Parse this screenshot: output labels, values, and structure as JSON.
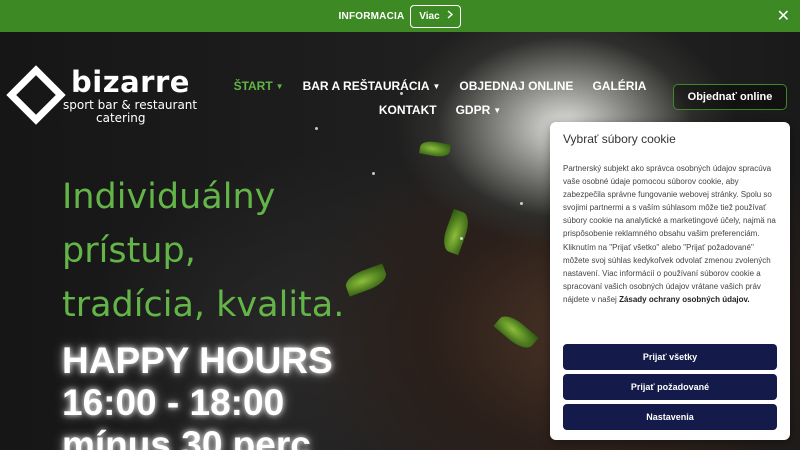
{
  "topbar": {
    "label": "INFORMACIA",
    "more_label": "Viac",
    "more_icon": "chevron-right-icon",
    "close_icon": "close-icon",
    "close_glyph": "✕",
    "background": "#3d8a25"
  },
  "logo": {
    "brand": "bizarre",
    "subtitle_1": "sport bar & restaurant",
    "subtitle_2": "catering"
  },
  "nav": {
    "items": [
      {
        "label": "ŠTART",
        "active": true,
        "has_dropdown": true
      },
      {
        "label": "BAR A REŠTAURÁCIA",
        "active": false,
        "has_dropdown": true
      },
      {
        "label": "OBJEDNAJ ONLINE",
        "active": false,
        "has_dropdown": false
      },
      {
        "label": "GALÉRIA",
        "active": false,
        "has_dropdown": false
      },
      {
        "label": "KONTAKT",
        "active": false,
        "has_dropdown": false
      },
      {
        "label": "GDPR",
        "active": false,
        "has_dropdown": true
      }
    ],
    "accent": "#62b545"
  },
  "order_button": {
    "label": "Objednať online"
  },
  "hero": {
    "lines": [
      "Individuálny",
      "prístup,",
      "tradícia, kvalita."
    ],
    "happy_lines": [
      "HAPPY HOURS",
      "16:00 - 18:00",
      "mínus 30 perc"
    ]
  },
  "cookie": {
    "title": "Vybrať súbory cookie",
    "text": "Partnerský subjekt ako správca osobných údajov spracúva vaše osobné údaje pomocou súborov cookie, aby zabezpečila správne fungovanie webovej stránky. Spolu so svojimi partnermi a s vaším súhlasom môže tiež používať súbory cookie na analytické a marketingové účely, najmä na prispôsobenie reklamného obsahu vašim preferenciám. Kliknutím na \"Prijať všetko\" alebo \"Prijať požadované\" môžete svoj súhlas kedykoľvek odvolať zmenou zvolených nastavení. Viac informácií o používaní súborov cookie a spracovaní vašich osobných údajov vrátane vašich práv nájdete v našej",
    "link": "Zásady ochrany osobných údajov.",
    "buttons": {
      "accept_all": "Prijať všetky",
      "accept_required": "Prijať požadované",
      "settings": "Nastavenia"
    },
    "button_color": "#141a4a"
  }
}
